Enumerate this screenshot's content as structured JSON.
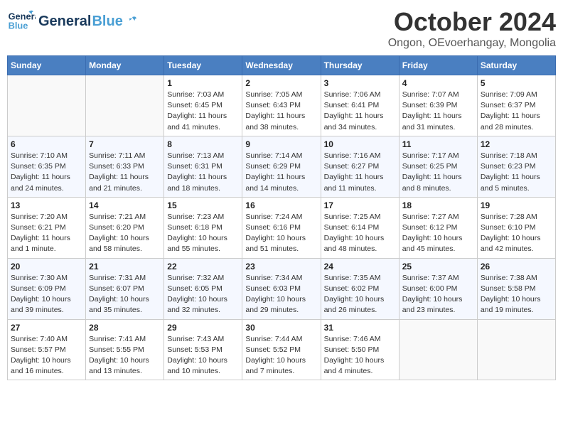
{
  "header": {
    "logo_line1": "General",
    "logo_line2": "Blue",
    "month": "October 2024",
    "location": "Ongon, OEvoerhangay, Mongolia"
  },
  "days_of_week": [
    "Sunday",
    "Monday",
    "Tuesday",
    "Wednesday",
    "Thursday",
    "Friday",
    "Saturday"
  ],
  "weeks": [
    [
      {
        "day": "",
        "info": ""
      },
      {
        "day": "",
        "info": ""
      },
      {
        "day": "1",
        "info": "Sunrise: 7:03 AM\nSunset: 6:45 PM\nDaylight: 11 hours and 41 minutes."
      },
      {
        "day": "2",
        "info": "Sunrise: 7:05 AM\nSunset: 6:43 PM\nDaylight: 11 hours and 38 minutes."
      },
      {
        "day": "3",
        "info": "Sunrise: 7:06 AM\nSunset: 6:41 PM\nDaylight: 11 hours and 34 minutes."
      },
      {
        "day": "4",
        "info": "Sunrise: 7:07 AM\nSunset: 6:39 PM\nDaylight: 11 hours and 31 minutes."
      },
      {
        "day": "5",
        "info": "Sunrise: 7:09 AM\nSunset: 6:37 PM\nDaylight: 11 hours and 28 minutes."
      }
    ],
    [
      {
        "day": "6",
        "info": "Sunrise: 7:10 AM\nSunset: 6:35 PM\nDaylight: 11 hours and 24 minutes."
      },
      {
        "day": "7",
        "info": "Sunrise: 7:11 AM\nSunset: 6:33 PM\nDaylight: 11 hours and 21 minutes."
      },
      {
        "day": "8",
        "info": "Sunrise: 7:13 AM\nSunset: 6:31 PM\nDaylight: 11 hours and 18 minutes."
      },
      {
        "day": "9",
        "info": "Sunrise: 7:14 AM\nSunset: 6:29 PM\nDaylight: 11 hours and 14 minutes."
      },
      {
        "day": "10",
        "info": "Sunrise: 7:16 AM\nSunset: 6:27 PM\nDaylight: 11 hours and 11 minutes."
      },
      {
        "day": "11",
        "info": "Sunrise: 7:17 AM\nSunset: 6:25 PM\nDaylight: 11 hours and 8 minutes."
      },
      {
        "day": "12",
        "info": "Sunrise: 7:18 AM\nSunset: 6:23 PM\nDaylight: 11 hours and 5 minutes."
      }
    ],
    [
      {
        "day": "13",
        "info": "Sunrise: 7:20 AM\nSunset: 6:21 PM\nDaylight: 11 hours and 1 minute."
      },
      {
        "day": "14",
        "info": "Sunrise: 7:21 AM\nSunset: 6:20 PM\nDaylight: 10 hours and 58 minutes."
      },
      {
        "day": "15",
        "info": "Sunrise: 7:23 AM\nSunset: 6:18 PM\nDaylight: 10 hours and 55 minutes."
      },
      {
        "day": "16",
        "info": "Sunrise: 7:24 AM\nSunset: 6:16 PM\nDaylight: 10 hours and 51 minutes."
      },
      {
        "day": "17",
        "info": "Sunrise: 7:25 AM\nSunset: 6:14 PM\nDaylight: 10 hours and 48 minutes."
      },
      {
        "day": "18",
        "info": "Sunrise: 7:27 AM\nSunset: 6:12 PM\nDaylight: 10 hours and 45 minutes."
      },
      {
        "day": "19",
        "info": "Sunrise: 7:28 AM\nSunset: 6:10 PM\nDaylight: 10 hours and 42 minutes."
      }
    ],
    [
      {
        "day": "20",
        "info": "Sunrise: 7:30 AM\nSunset: 6:09 PM\nDaylight: 10 hours and 39 minutes."
      },
      {
        "day": "21",
        "info": "Sunrise: 7:31 AM\nSunset: 6:07 PM\nDaylight: 10 hours and 35 minutes."
      },
      {
        "day": "22",
        "info": "Sunrise: 7:32 AM\nSunset: 6:05 PM\nDaylight: 10 hours and 32 minutes."
      },
      {
        "day": "23",
        "info": "Sunrise: 7:34 AM\nSunset: 6:03 PM\nDaylight: 10 hours and 29 minutes."
      },
      {
        "day": "24",
        "info": "Sunrise: 7:35 AM\nSunset: 6:02 PM\nDaylight: 10 hours and 26 minutes."
      },
      {
        "day": "25",
        "info": "Sunrise: 7:37 AM\nSunset: 6:00 PM\nDaylight: 10 hours and 23 minutes."
      },
      {
        "day": "26",
        "info": "Sunrise: 7:38 AM\nSunset: 5:58 PM\nDaylight: 10 hours and 19 minutes."
      }
    ],
    [
      {
        "day": "27",
        "info": "Sunrise: 7:40 AM\nSunset: 5:57 PM\nDaylight: 10 hours and 16 minutes."
      },
      {
        "day": "28",
        "info": "Sunrise: 7:41 AM\nSunset: 5:55 PM\nDaylight: 10 hours and 13 minutes."
      },
      {
        "day": "29",
        "info": "Sunrise: 7:43 AM\nSunset: 5:53 PM\nDaylight: 10 hours and 10 minutes."
      },
      {
        "day": "30",
        "info": "Sunrise: 7:44 AM\nSunset: 5:52 PM\nDaylight: 10 hours and 7 minutes."
      },
      {
        "day": "31",
        "info": "Sunrise: 7:46 AM\nSunset: 5:50 PM\nDaylight: 10 hours and 4 minutes."
      },
      {
        "day": "",
        "info": ""
      },
      {
        "day": "",
        "info": ""
      }
    ]
  ]
}
